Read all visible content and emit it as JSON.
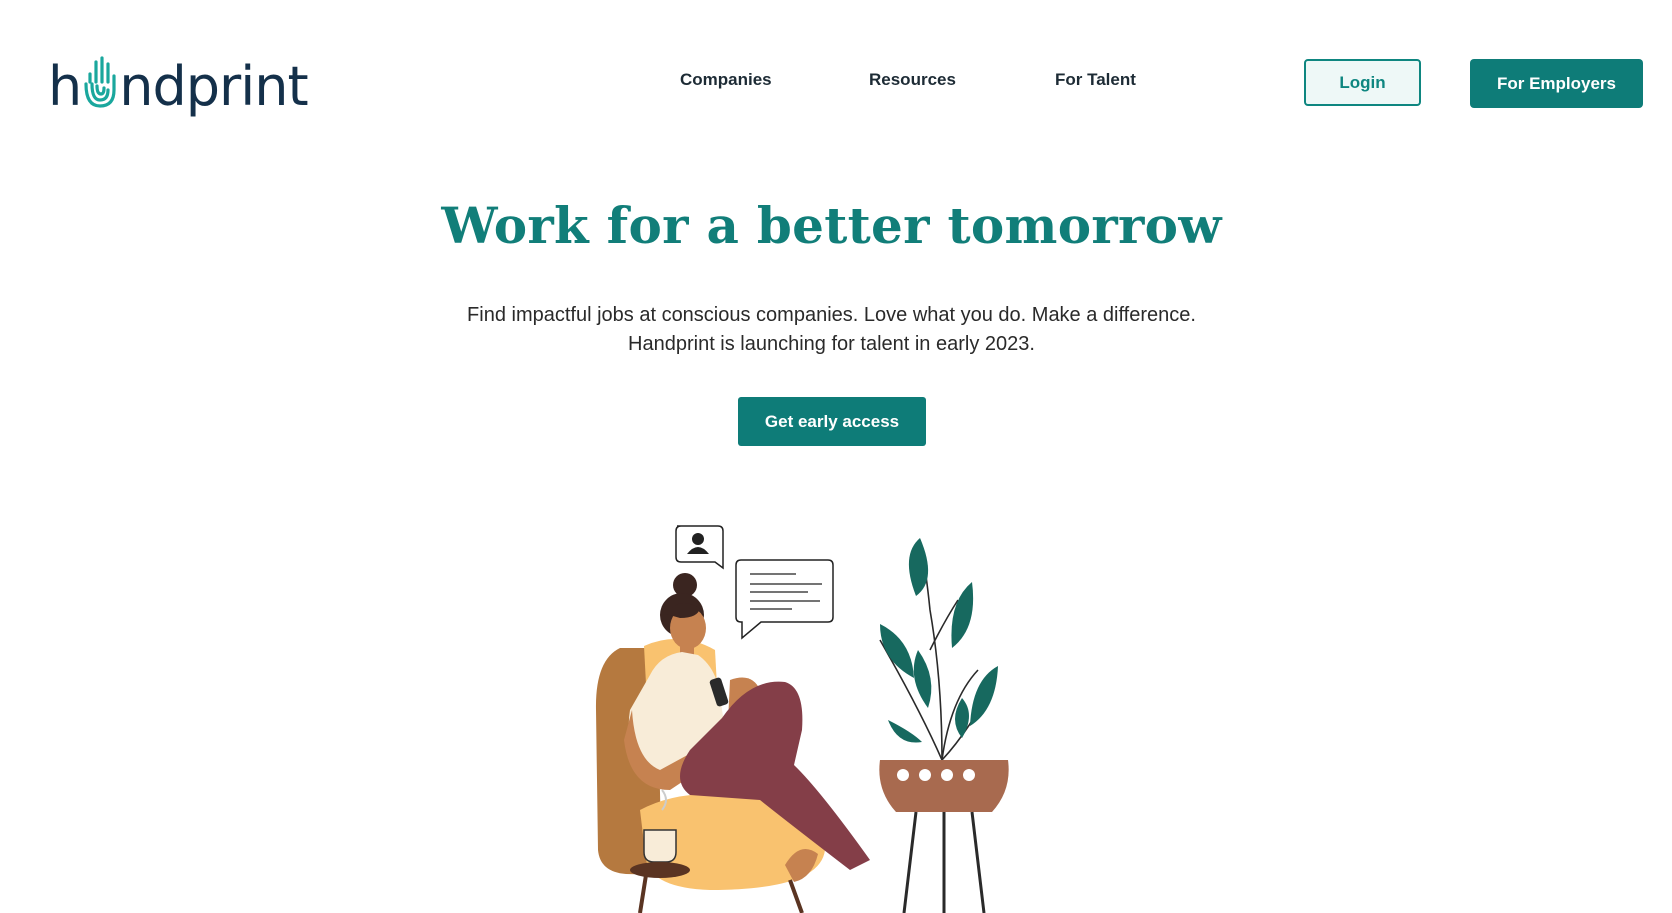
{
  "brand": {
    "logo_prefix": "h",
    "logo_suffix": "ndprint",
    "logo_icon": "hand-icon"
  },
  "nav": {
    "items": [
      {
        "label": "Companies"
      },
      {
        "label": "Resources"
      },
      {
        "label": "For Talent"
      }
    ],
    "login_label": "Login",
    "employers_label": "For Employers"
  },
  "hero": {
    "title": "Work for a better tomorrow",
    "subtitle_line1": "Find impactful jobs at conscious companies. Love what you do. Make a difference.",
    "subtitle_line2": "Handprint is launching for talent in early 2023.",
    "cta_label": "Get early access"
  },
  "illustration": {
    "icon": "woman-on-phone-illustration",
    "elements": [
      "profile-chat-bubble",
      "message-chat-bubble",
      "armchair",
      "woman",
      "smartphone",
      "coffee-cup",
      "potted-plant"
    ]
  },
  "colors": {
    "brand_teal": "#0e7c78",
    "heading_teal": "#117e79",
    "logo_navy": "#14304a",
    "login_bg": "#eef8f7",
    "plant_green": "#17695f",
    "chair_orange": "#b5793f",
    "seat_yellow": "#f9c26f",
    "pants_maroon": "#843e48",
    "pot_brown": "#a86a4f"
  }
}
